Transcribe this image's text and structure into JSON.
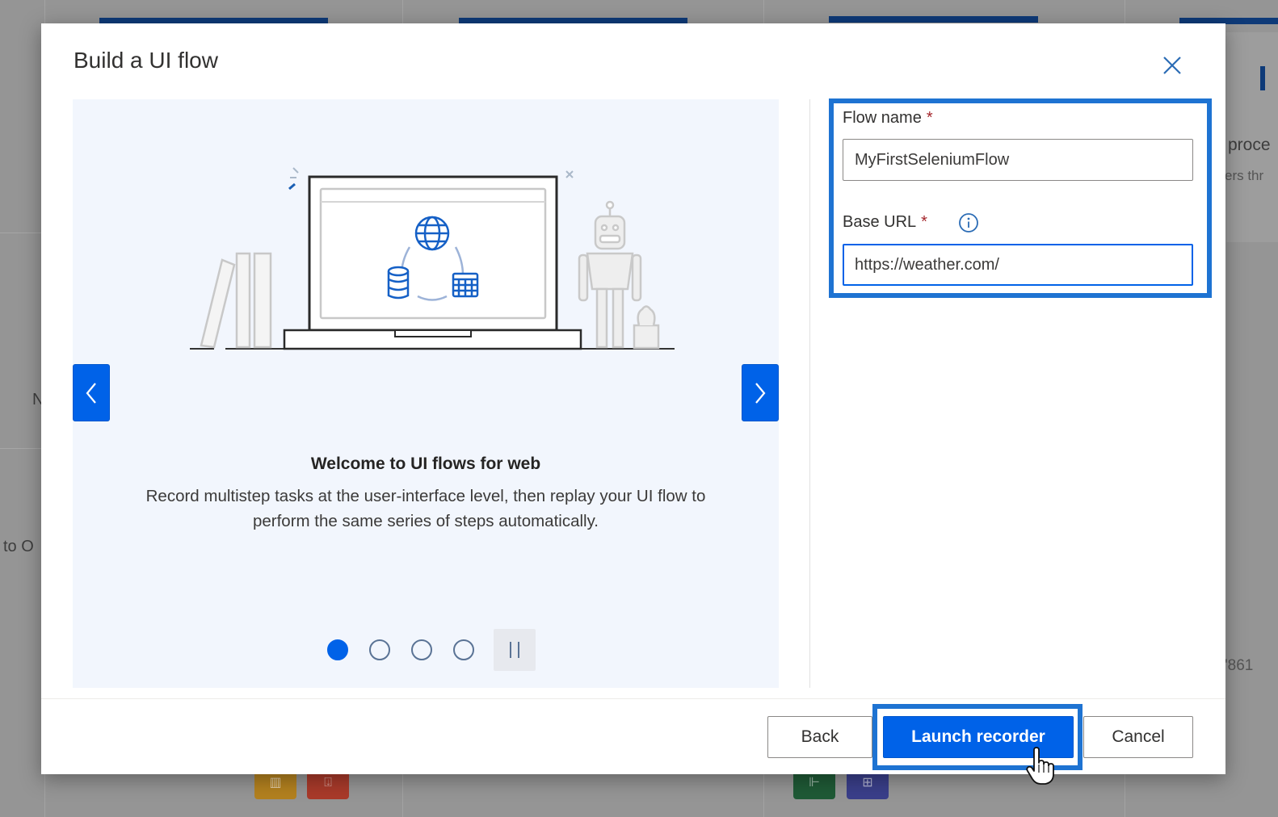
{
  "background": {
    "partial_texts": {
      "left_upper": "N",
      "left_lower": "to O",
      "right_heading": "proce",
      "right_sub": "ers thr",
      "right_number": "'861"
    },
    "tile_colors": [
      "#b3811f",
      "#a93a2a",
      "#1f5a36",
      "#3a3f8a"
    ]
  },
  "modal": {
    "title": "Build a UI flow",
    "close_label": "Close",
    "carousel": {
      "slide_title": "Welcome to UI flows for web",
      "slide_description": "Record multistep tasks at the user-interface level, then replay your UI flow to perform the same series of steps automatically.",
      "prev_label": "Previous slide",
      "next_label": "Next slide",
      "total_slides": 4,
      "active_slide": 1,
      "pause_label": "Pause"
    },
    "form": {
      "flow_name_label": "Flow name",
      "flow_name_value": "MyFirstSeleniumFlow",
      "base_url_label": "Base URL",
      "base_url_value": "https://weather.com/",
      "required_marker": "*",
      "info_tooltip_label": "More info about Base URL"
    },
    "footer": {
      "back_label": "Back",
      "launch_label": "Launch recorder",
      "cancel_label": "Cancel"
    }
  },
  "colors": {
    "accent": "#0062e8",
    "highlight_frame": "#1e73d2",
    "required": "#a4262c",
    "carousel_bg": "#f2f6fd"
  }
}
